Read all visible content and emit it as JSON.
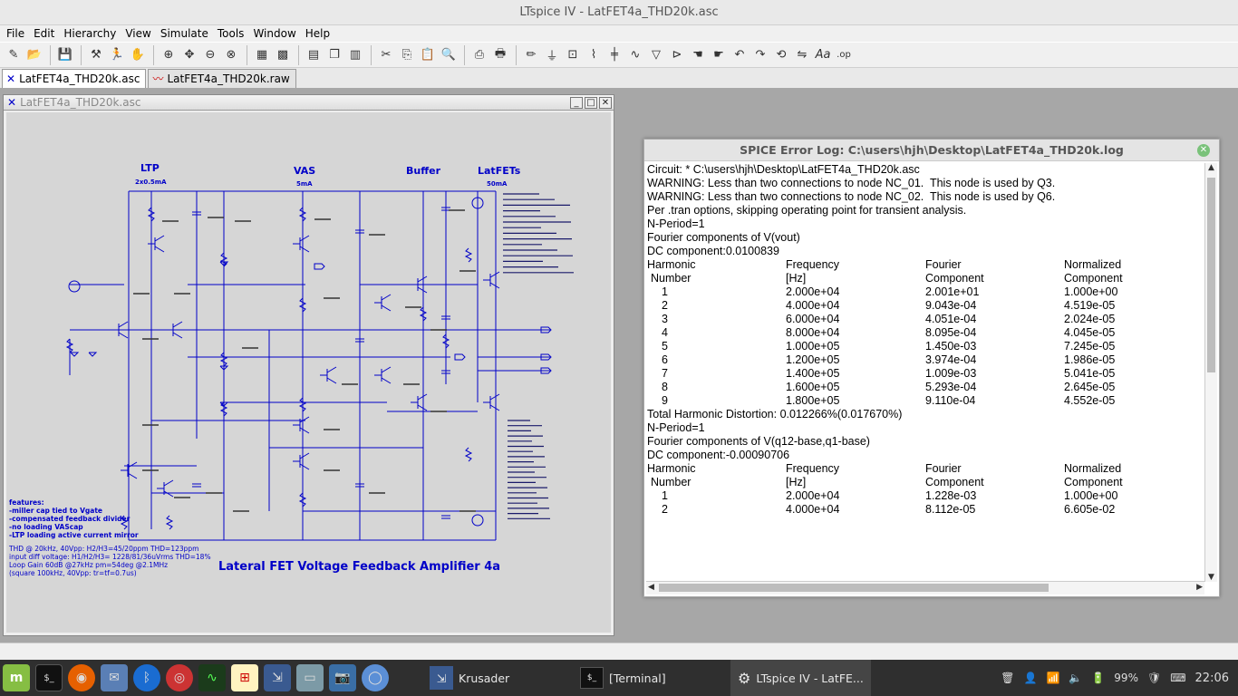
{
  "window": {
    "title": "LTspice IV - LatFET4a_THD20k.asc"
  },
  "menu": [
    "File",
    "Edit",
    "Hierarchy",
    "View",
    "Simulate",
    "Tools",
    "Window",
    "Help"
  ],
  "tabs": [
    {
      "label": "LatFET4a_THD20k.asc",
      "icon": "schematic-icon"
    },
    {
      "label": "LatFET4a_THD20k.raw",
      "icon": "waveform-icon"
    }
  ],
  "schematic": {
    "title": "LatFET4a_THD20k.asc",
    "main_title": "Lateral FET Voltage Feedback Amplifier 4a",
    "sections": [
      {
        "label": "LTP",
        "sub": "2x0.5mA"
      },
      {
        "label": "VAS",
        "sub": "5mA"
      },
      {
        "label": "Buffer",
        "sub": ""
      },
      {
        "label": "LatFETs",
        "sub": "50mA"
      }
    ],
    "features": [
      "features:",
      "-miller cap tied to Vgate",
      "-compensated feedback divider",
      "-no loading VAScap",
      "-LTP loading active current mirror"
    ],
    "specs": [
      "THD @ 20kHz, 40Vpp: H2/H3=45/20ppm THD=123ppm",
      "input diff voltage: H1/H2/H3= 1228/81/36uVrms THD=18%",
      "Loop Gain 60dB @27kHz pm=54deg @2.1MHz",
      "(square 100kHz, 40Vpp: tr=tf=0.7us)"
    ],
    "colors": {
      "wire": "#0000c8",
      "bg": "#d6d6d6",
      "label": "#0000c8"
    }
  },
  "log": {
    "title": "SPICE Error Log: C:\\users\\hjh\\Desktop\\LatFET4a_THD20k.log",
    "lines": [
      "Circuit: * C:\\users\\hjh\\Desktop\\LatFET4a_THD20k.asc",
      "",
      "WARNING: Less than two connections to node NC_01.  This node is used by Q3.",
      "WARNING: Less than two connections to node NC_02.  This node is used by Q6.",
      "Per .tran options, skipping operating point for transient analysis.",
      "N-Period=1",
      "Fourier components of V(vout)",
      "DC component:0.0100839",
      "",
      "TABLE1",
      "Total Harmonic Distortion: 0.012266%(0.017670%)",
      "",
      "",
      "N-Period=1",
      "Fourier components of V(q12-base,q1-base)",
      "DC component:-0.00090706",
      "",
      "TABLE2"
    ],
    "table_headers": [
      [
        "Harmonic",
        "Frequency",
        "Fourier",
        "Normalized"
      ],
      [
        "Number",
        "[Hz]",
        "Component",
        "Component"
      ]
    ],
    "table1": [
      [
        "1",
        "2.000e+04",
        "2.001e+01",
        "1.000e+00"
      ],
      [
        "2",
        "4.000e+04",
        "9.043e-04",
        "4.519e-05"
      ],
      [
        "3",
        "6.000e+04",
        "4.051e-04",
        "2.024e-05"
      ],
      [
        "4",
        "8.000e+04",
        "8.095e-04",
        "4.045e-05"
      ],
      [
        "5",
        "1.000e+05",
        "1.450e-03",
        "7.245e-05"
      ],
      [
        "6",
        "1.200e+05",
        "3.974e-04",
        "1.986e-05"
      ],
      [
        "7",
        "1.400e+05",
        "1.009e-03",
        "5.041e-05"
      ],
      [
        "8",
        "1.600e+05",
        "5.293e-04",
        "2.645e-05"
      ],
      [
        "9",
        "1.800e+05",
        "9.110e-04",
        "4.552e-05"
      ]
    ],
    "table2": [
      [
        "1",
        "2.000e+04",
        "1.228e-03",
        "1.000e+00"
      ],
      [
        "2",
        "4.000e+04",
        "8.112e-05",
        "6.605e-02"
      ]
    ]
  },
  "taskbar": {
    "windows": [
      {
        "label": "Krusader",
        "icon": "krusader-icon"
      },
      {
        "label": "[Terminal]",
        "icon": "terminal-icon"
      },
      {
        "label": "LTspice IV - LatFE...",
        "icon": "gear-icon"
      }
    ],
    "battery": "99%",
    "clock": "22:06"
  }
}
